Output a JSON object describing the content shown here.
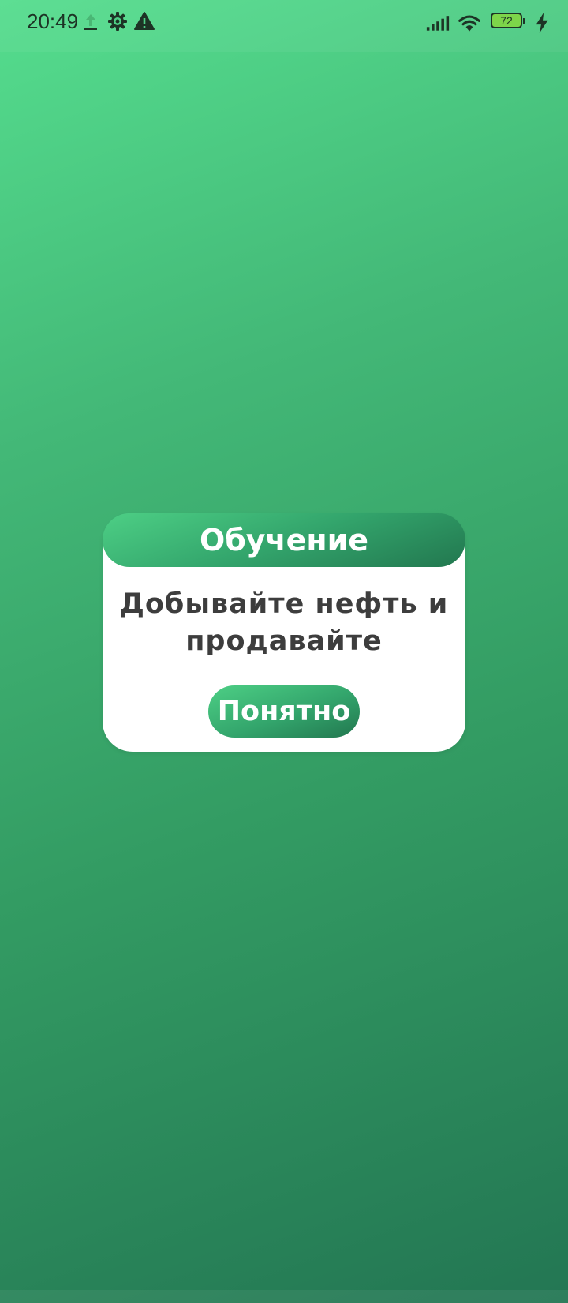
{
  "status_bar": {
    "time": "20:49",
    "battery_level": "72",
    "icons": [
      "upload-icon",
      "settings-icon",
      "warning-icon",
      "signal-icon",
      "wifi-icon",
      "battery-icon",
      "charging-icon"
    ]
  },
  "dialog": {
    "title": "Обучение",
    "message": "Добывайте нефть и продавайте",
    "button_label": "Понятно"
  },
  "colors": {
    "background_top": "#55dd8e",
    "background_bottom": "#237653",
    "dialog_bg": "#ffffff",
    "text_dark": "#3d3d3d",
    "accent": "#33a56c"
  }
}
